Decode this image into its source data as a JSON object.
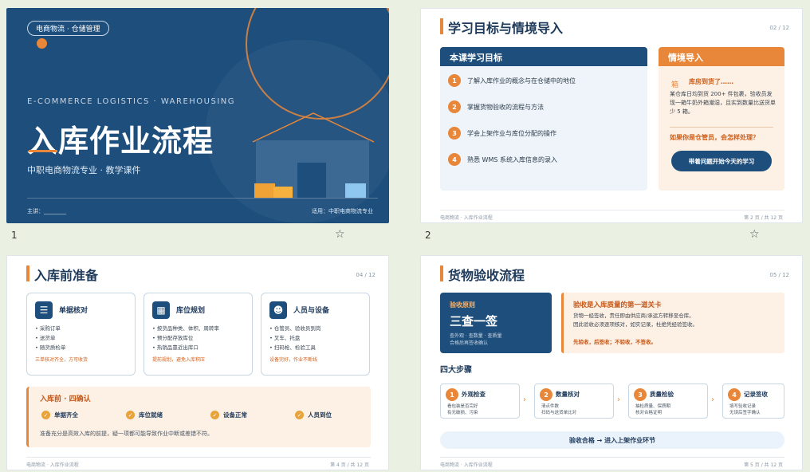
{
  "slides": [
    {
      "number": "1",
      "tag": "电商物流 · 仓储管理",
      "en_title": "E-COMMERCE LOGISTICS · WAREHOUSING",
      "title": "入库作业流程",
      "subtitle": "中职电商物流专业 · 教学课件",
      "presenter": "主讲：________",
      "applies": "适用：中职电商物流专业"
    },
    {
      "number": "2",
      "title": "学习目标与情境导入",
      "page": "02 / 12",
      "goals_title": "本课学习目标",
      "goals": [
        {
          "n": "1",
          "text": "了解入库作业的概念与在仓储中的地位"
        },
        {
          "n": "2",
          "text": "掌握货物验收的流程与方法"
        },
        {
          "n": "3",
          "text": "学会上架作业与库位分配的操作"
        },
        {
          "n": "4",
          "text": "熟悉 WMS 系统入库信息的录入"
        }
      ],
      "intro_title": "情境导入",
      "box_glyph": "箱",
      "arrive": "库房到货了……",
      "story": "某仓库日均到货 200+ 件包裹，验收员发现一箱牛奶外箱潮湿，且实到数量比送货单少 5 箱。",
      "question": "如果你是仓管员，会怎样处理？",
      "cta": "带着问题开始今天的学习",
      "footer_left": "电商物流 · 入库作业流程",
      "footer_right": "第 2 页 / 共 12 页"
    },
    {
      "number": "3",
      "title": "入库前准备",
      "page": "04 / 12",
      "cards": [
        {
          "icon": "☰",
          "title": "单据核对",
          "items": [
            "• 采购订单",
            "• 送货单",
            "• 随货质检单"
          ],
          "note": "三单核对齐全，方可收货"
        },
        {
          "icon": "▦",
          "title": "库位规划",
          "items": [
            "• 按货品种类、体积、周转率",
            "• 预分配存放库位",
            "• 热销品靠近出库口"
          ],
          "note": "提前规划，避免入库积压"
        },
        {
          "icon": "☻",
          "title": "人员与设备",
          "items": [
            "• 仓管员、验收员到岗",
            "• 叉车、托盘",
            "• 扫码枪、检验工具"
          ],
          "note": "设备完好，作业不断线"
        }
      ],
      "confirm_title": "入库前 · 四确认",
      "checks": [
        "单据齐全",
        "库位就绪",
        "设备正常",
        "人员到位"
      ],
      "confirm_note": "准备充分是高效入库的前提，疑一项都可能导致作业中断或差错不符。",
      "footer_left": "电商物流 · 入库作业流程",
      "footer_right": "第 4 页 / 共 12 页"
    },
    {
      "number": "4",
      "title": "货物验收流程",
      "page": "05 / 12",
      "principle_label": "验收原则",
      "principle_title": "三查一签",
      "principle_desc": "查外观 · 查数量 · 查质量\n合格后再签收确认",
      "quality_title": "验收是入库质量的第一道关卡",
      "quality_desc": "货物一经签收，责任即由供应商/承运方转移至仓库。\n因此验收必须逐项核对，如实记录，杜绝凭经验签收。",
      "quality_warn": "先验收，后签收；不验收，不签收。",
      "steps_title": "四大步骤",
      "steps": [
        {
          "n": "1",
          "title": "外观检查",
          "desc": "看包装是否完好\n有无破损、污染"
        },
        {
          "n": "2",
          "title": "数量核对",
          "desc": "清点件数\n扫码与送货单比对"
        },
        {
          "n": "3",
          "title": "质量检验",
          "desc": "抽检质量、保质期\n核对合格证明"
        },
        {
          "n": "4",
          "title": "记录签收",
          "desc": "填写验收记录\n无误后签字确认"
        }
      ],
      "pass": "验收合格 → 进入上架作业环节",
      "footer_left": "电商物流 · 入库作业流程",
      "footer_right": "第 5 页 / 共 12 页"
    }
  ],
  "accent_color": "#e8873a",
  "primary_color": "#1e4f7c"
}
